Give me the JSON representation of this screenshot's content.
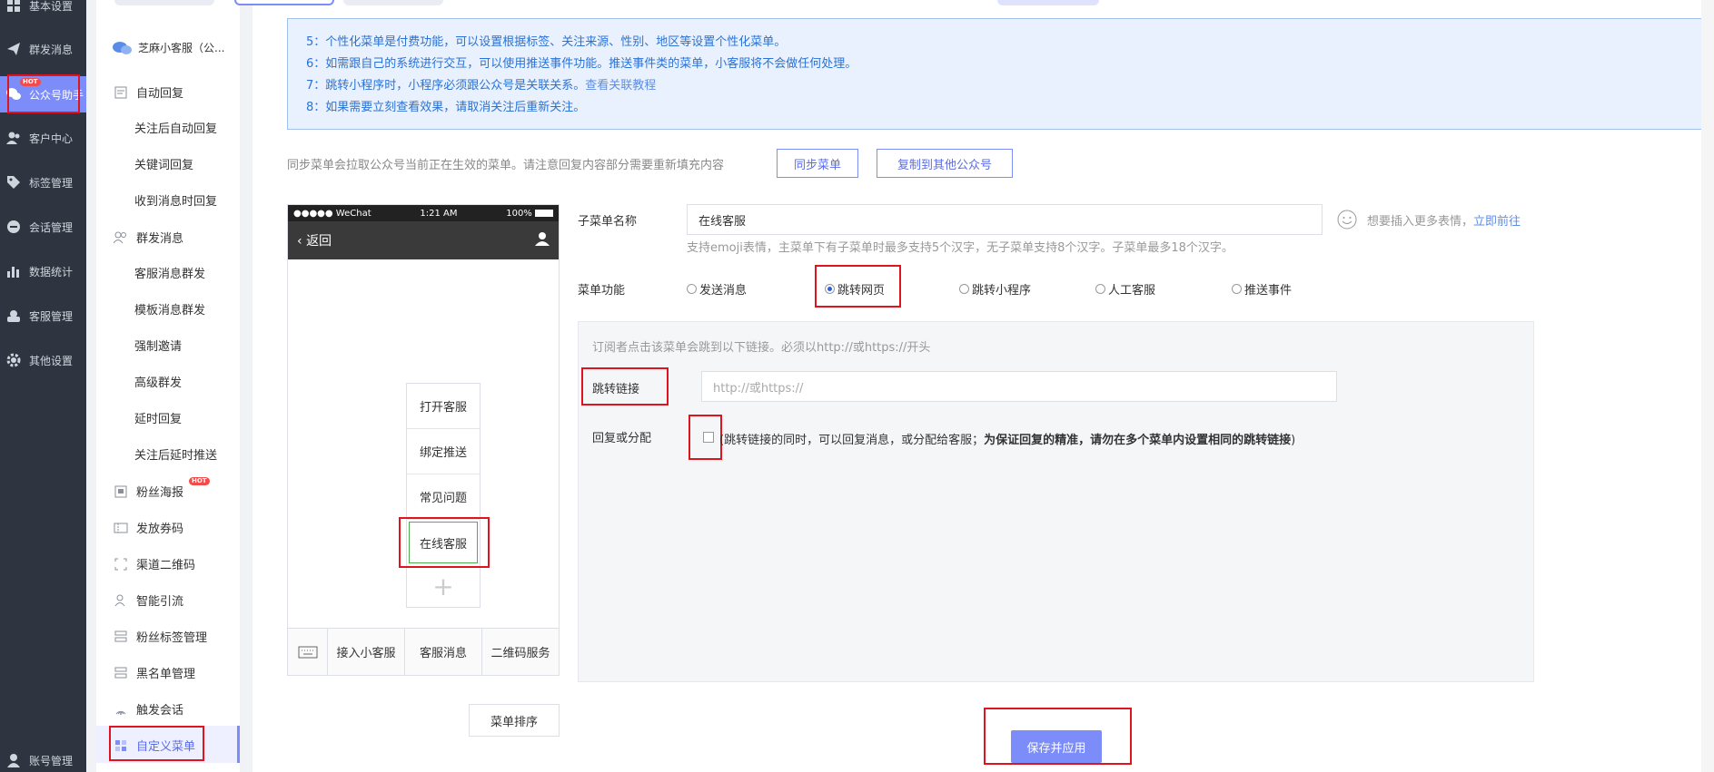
{
  "nav": {
    "items": [
      {
        "label": "基本设置",
        "icon": "grid-icon"
      },
      {
        "label": "群发消息",
        "icon": "send-icon"
      },
      {
        "label": "公众号助手",
        "icon": "wechat-icon",
        "badge": "HOT"
      },
      {
        "label": "客户中心",
        "icon": "users-icon"
      },
      {
        "label": "标签管理",
        "icon": "tag-icon"
      },
      {
        "label": "会话管理",
        "icon": "chat-icon"
      },
      {
        "label": "数据统计",
        "icon": "bar-chart-icon"
      },
      {
        "label": "客服管理",
        "icon": "agent-icon"
      },
      {
        "label": "其他设置",
        "icon": "gear-icon"
      },
      {
        "label": "账号管理",
        "icon": "account-icon"
      }
    ]
  },
  "sub": {
    "account": "芝麻小客服（公...",
    "auto_reply": "自动回复",
    "auto_children": [
      "关注后自动回复",
      "关键词回复",
      "收到消息时回复"
    ],
    "mass": "群发消息",
    "mass_children": [
      "客服消息群发",
      "模板消息群发",
      "强制邀请",
      "高级群发",
      "延时回复",
      "关注后延时推送"
    ],
    "items": [
      {
        "label": "粉丝海报",
        "badge": "HOT"
      },
      {
        "label": "发放券码"
      },
      {
        "label": "渠道二维码"
      },
      {
        "label": "智能引流"
      },
      {
        "label": "粉丝标签管理"
      },
      {
        "label": "黑名单管理"
      },
      {
        "label": "触发会话"
      },
      {
        "label": "自定义菜单"
      }
    ]
  },
  "notice": {
    "line5": "5：个性化菜单是付费功能，可以设置根据标签、关注来源、性别、地区等设置个性化菜单。",
    "line6": "6：如需跟自己的系统进行交互，可以使用推送事件功能。推送事件类的菜单，小客服将不会做任何处理。",
    "line7": "7：跳转小程序时，小程序必须跟公众号是关联关系。",
    "line7_link": "查看关联教程",
    "line8": "8：如果需要立刻查看效果，请取消关注后重新关注。"
  },
  "sync": {
    "text": "同步菜单会拉取公众号当前正在生效的菜单。请注意回复内容部分需要重新填充内容",
    "sync_btn": "同步菜单",
    "copy_btn": "复制到其他公众号"
  },
  "phone": {
    "carrier": "●●●●● WeChat",
    "time": "1:21 AM",
    "battery": "100%",
    "back": "返回",
    "submenu": [
      "打开客服",
      "绑定推送",
      "常见问题",
      "在线客服"
    ],
    "bottom": [
      "接入小客服",
      "客服消息",
      "二维码服务"
    ],
    "sort_btn": "菜单排序"
  },
  "form": {
    "name_label": "子菜单名称",
    "name_value": "在线客服",
    "emoji_hint": "想要插入更多表情，",
    "emoji_link": "立即前往",
    "name_help": "支持emoji表情，主菜单下有子菜单时最多支持5个汉字，无子菜单支持8个汉字。子菜单最多18个汉字。",
    "func_label": "菜单功能",
    "options": [
      "发送消息",
      "跳转网页",
      "跳转小程序",
      "人工客服",
      "推送事件"
    ],
    "selected": "跳转网页",
    "panel_hint": "订阅者点击该菜单会跳到以下链接。必须以http://或https://开头",
    "link_label": "跳转链接",
    "link_placeholder": "http://或https://",
    "reply_label": "回复或分配",
    "reply_text": "跳转链接的同时，可以回复消息，或分配给客服；",
    "reply_bold": "为保证回复的精准，请勿在多个菜单内设置相同的跳转链接",
    "reply_open": "(",
    "reply_close": ")",
    "save_btn": "保存并应用"
  }
}
